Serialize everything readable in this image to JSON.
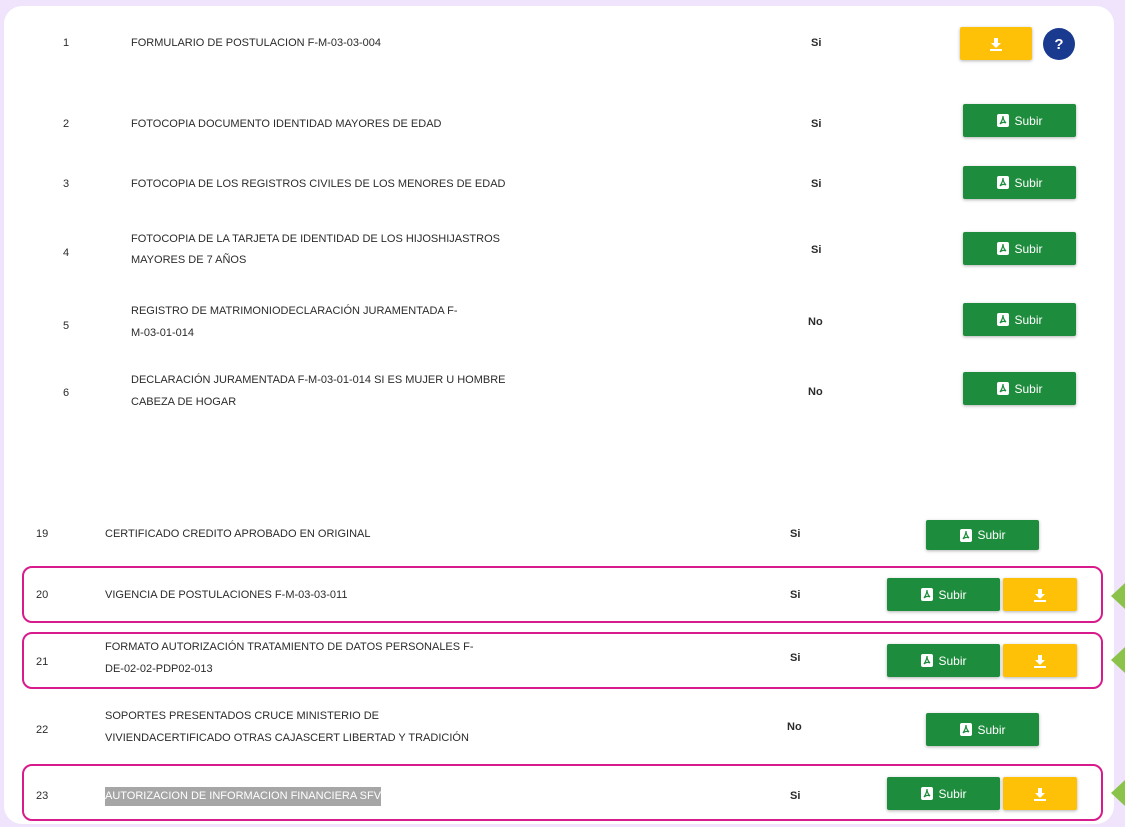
{
  "colors": {
    "accent_green": "#1e8c3d",
    "accent_yellow": "#ffc107",
    "help_blue": "#1a3a8f",
    "highlight_pink": "#d81b8c",
    "marker_green": "#8bc34a"
  },
  "upload_label": "Subir",
  "rows": [
    {
      "num": "1",
      "doc": "FORMULARIO DE POSTULACION F-M-03-03-004",
      "req": "Si"
    },
    {
      "num": "2",
      "doc": "FOTOCOPIA DOCUMENTO IDENTIDAD MAYORES DE EDAD",
      "req": "Si"
    },
    {
      "num": "3",
      "doc": "FOTOCOPIA DE LOS REGISTROS CIVILES DE LOS MENORES DE EDAD",
      "req": "Si"
    },
    {
      "num": "4",
      "doc_line1": "FOTOCOPIA DE LA TARJETA DE IDENTIDAD DE LOS HIJOSHIJASTROS",
      "doc_line2": "MAYORES DE 7 AÑOS",
      "req": "Si"
    },
    {
      "num": "5",
      "doc_line1": "REGISTRO DE MATRIMONIODECLARACIÓN JURAMENTADA F-",
      "doc_line2": "M-03-01-014",
      "req": "No"
    },
    {
      "num": "6",
      "doc_line1": "DECLARACIÓN JURAMENTADA F-M-03-01-014 SI ES MUJER U HOMBRE",
      "doc_line2": "CABEZA DE HOGAR",
      "req": "No"
    },
    {
      "num": "19",
      "doc": "CERTIFICADO CREDITO APROBADO EN ORIGINAL",
      "req": "Si"
    },
    {
      "num": "20",
      "doc": "VIGENCIA DE POSTULACIONES F-M-03-03-011",
      "req": "Si"
    },
    {
      "num": "21",
      "doc_line1": "FORMATO AUTORIZACIÓN TRATAMIENTO DE DATOS PERSONALES F-",
      "doc_line2": "DE-02-02-PDP02-013",
      "req": "Si"
    },
    {
      "num": "22",
      "doc_line1": "SOPORTES PRESENTADOS CRUCE MINISTERIO DE",
      "doc_line2": "VIVIENDACERTIFICADO OTRAS CAJASCERT LIBERTAD Y TRADICIÓN",
      "req": "No"
    },
    {
      "num": "23",
      "doc": "AUTORIZACION DE INFORMACION FINANCIERA SFV",
      "req": "Si"
    }
  ]
}
